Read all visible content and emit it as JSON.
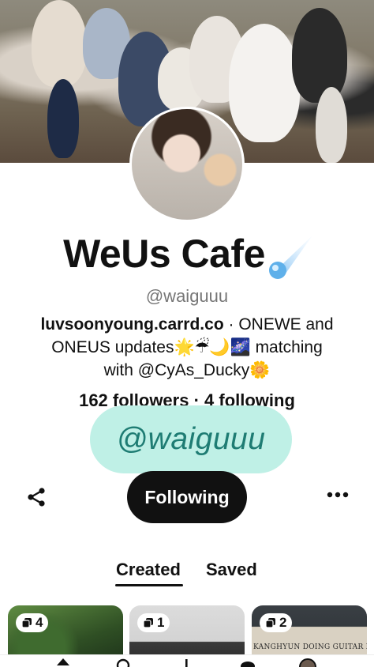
{
  "profile": {
    "name": "WeUs Cafe",
    "handle": "@waiguuu",
    "bio_link": "luvsoonyoung.carrd.co",
    "bio_line1": " · ONEWE and",
    "bio_line2": "ONEUS updates🌟☔🌙🌌 matching",
    "bio_line3": "with @CyAs_Ducky🌼",
    "stats": "162 followers · 4 following"
  },
  "watermark": "@waiguuu",
  "actions": {
    "follow_label": "Following"
  },
  "tabs": [
    {
      "label": "Created",
      "active": true
    },
    {
      "label": "Saved",
      "active": false
    }
  ],
  "boards": [
    {
      "count": "4",
      "caption": ""
    },
    {
      "count": "1",
      "caption": ""
    },
    {
      "count": "2",
      "caption": "KANGHYUN DOING GUITAR RIFFS"
    }
  ],
  "icons": {
    "share": "share-icon",
    "more": "more-icon",
    "board": "board-stack-icon",
    "comet": "comet-icon"
  }
}
